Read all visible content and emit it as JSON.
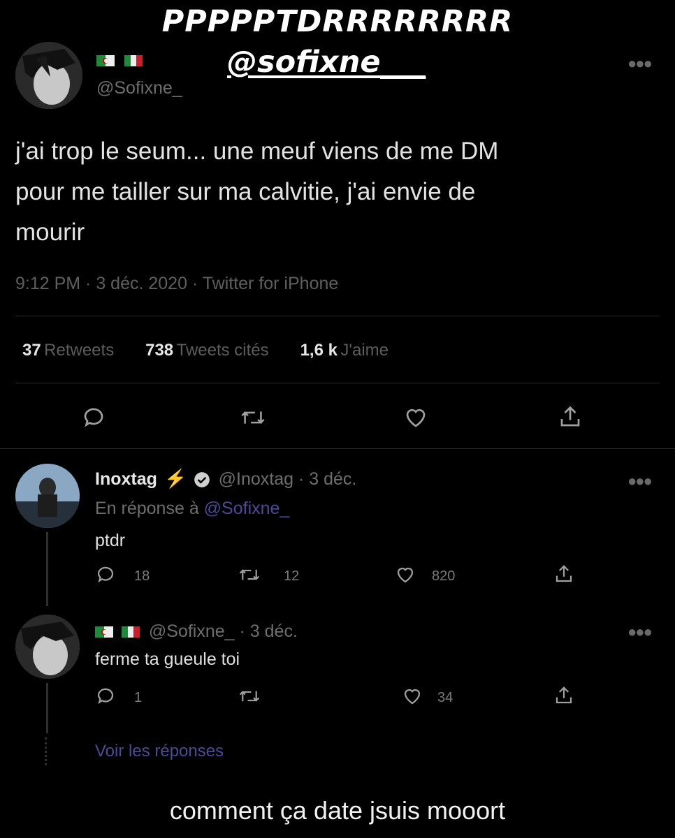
{
  "overlay": {
    "title": "PPPPPTDRRRRRRRR",
    "handle": "@sofixne___",
    "caption": "comment ça date jsuis mooort"
  },
  "main_tweet": {
    "handle": "@Sofixne_",
    "text_lines": [
      "j'ai trop le seum... une meuf viens de me DM",
      "pour me tailler sur ma calvitie, j'ai envie de",
      "mourir"
    ],
    "meta": "9:12 PM · 3 déc. 2020 · Twitter for iPhone",
    "stats": {
      "retweets_count": "37",
      "retweets_label": "Retweets",
      "quotes_count": "738",
      "quotes_label": "Tweets cités",
      "likes_count": "1,6 k",
      "likes_label": "J'aime"
    }
  },
  "replies": [
    {
      "name": "Inoxtag",
      "emoji": "⚡",
      "handle_date": "@Inoxtag · 3 déc.",
      "reply_prefix": "En réponse à ",
      "reply_to": "@Sofixne_",
      "text": "ptdr",
      "replies": "18",
      "retweets": "12",
      "likes": "820"
    },
    {
      "handle_date": "@Sofixne_ · 3 déc.",
      "text": "ferme ta gueule toi",
      "replies": "1",
      "likes": "34",
      "see_replies": "Voir les réponses"
    }
  ],
  "colors": {
    "background": "#000000",
    "link": "#4a4a99",
    "verified": "#cfcfcf",
    "bolt": "#f5a623"
  },
  "icons": [
    "flag-algeria-icon",
    "flag-italy-icon",
    "more-icon",
    "reply-icon",
    "retweet-icon",
    "like-icon",
    "share-icon",
    "verified-icon",
    "lightning-icon"
  ]
}
